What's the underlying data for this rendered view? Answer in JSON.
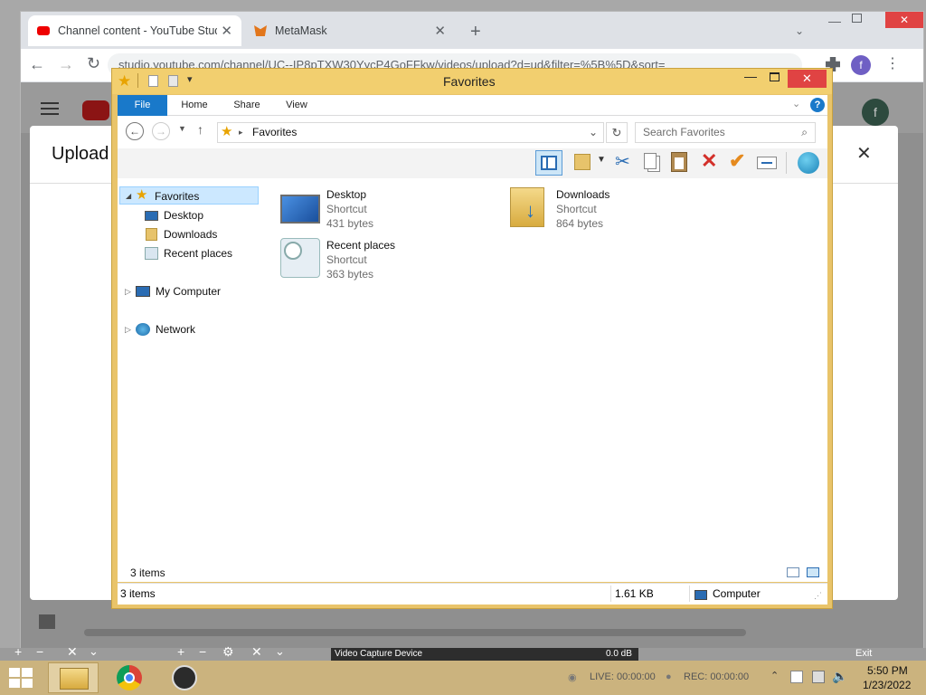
{
  "browser": {
    "tabs": [
      {
        "title": "Channel content - YouTube Studi",
        "icon": "youtube-icon"
      },
      {
        "title": "MetaMask",
        "icon": "metamask-fox-icon"
      }
    ],
    "new_tab_glyph": "+",
    "url": "studio.youtube.com/channel/UC--IP8pTXW30YycP4GoFFkw/videos/upload?d=ud&filter=%5B%5D&sort=",
    "profile_letter": "f",
    "upload_dialog_title": "Upload",
    "avatar_letter": "f"
  },
  "explorer": {
    "title": "Favorites",
    "ribbon_tabs": [
      "File",
      "Home",
      "Share",
      "View"
    ],
    "address": "Favorites",
    "search_placeholder": "Search Favorites",
    "nav": {
      "favorites": "Favorites",
      "fav_children": [
        "Desktop",
        "Downloads",
        "Recent places"
      ],
      "my_computer": "My Computer",
      "network": "Network"
    },
    "items": [
      {
        "name": "Desktop",
        "type": "Shortcut",
        "size": "431 bytes",
        "icon": "desktop-monitor-icon"
      },
      {
        "name": "Downloads",
        "type": "Shortcut",
        "size": "864 bytes",
        "icon": "downloads-folder-icon"
      },
      {
        "name": "Recent places",
        "type": "Shortcut",
        "size": "363 bytes",
        "icon": "recent-places-icon"
      }
    ],
    "status_count": "3 items",
    "statusbar": {
      "count": "3 items",
      "size": "1.61 KB",
      "location": "Computer"
    }
  },
  "obs": {
    "source_label": "Video Capture Device",
    "db": "0.0 dB",
    "exit": "Exit",
    "live": "LIVE: 00:00:00",
    "rec": "REC: 00:00:00"
  },
  "taskbar": {
    "time": "5:50 PM",
    "date": "1/23/2022"
  },
  "colors": {
    "explorer_frame": "#e9c46a",
    "ribbon_file": "#1979ca",
    "close_red": "#e04343",
    "taskbar": "#cbb37e"
  }
}
